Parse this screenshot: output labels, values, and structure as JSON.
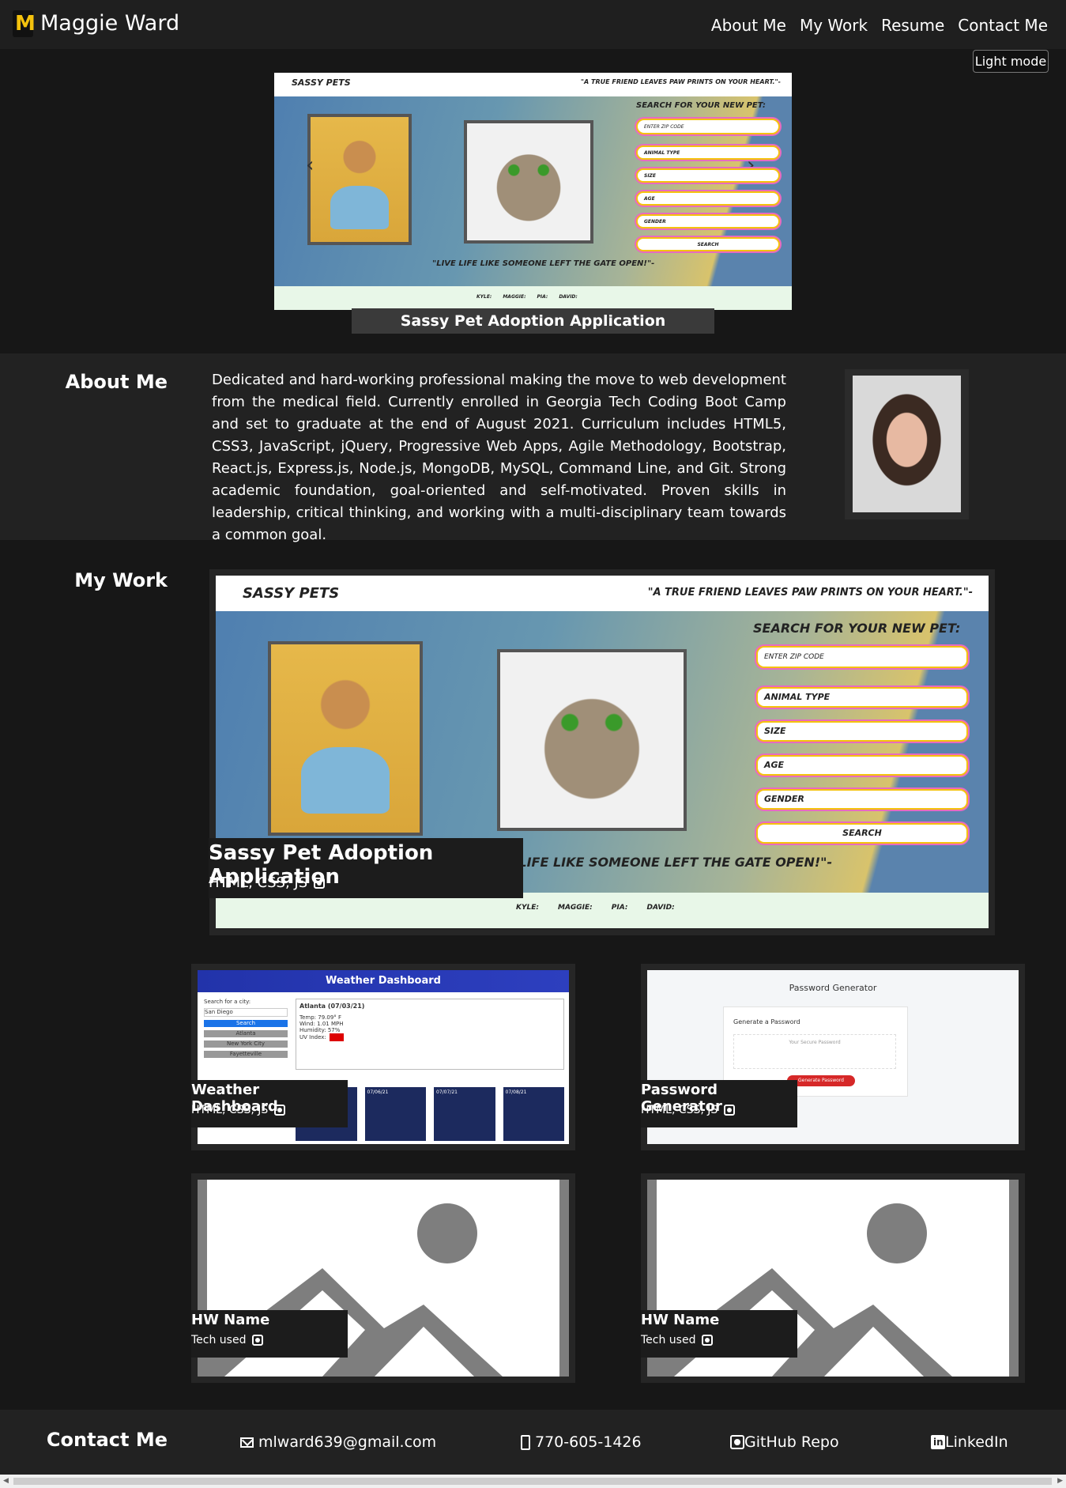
{
  "nav": {
    "brand": "Maggie Ward",
    "links": [
      "About Me",
      "My Work",
      "Resume",
      "Contact Me"
    ],
    "mode_button": "Light mode"
  },
  "hero": {
    "caption": "Sassy Pet Adoption Application"
  },
  "shot_text": {
    "brand": "SASSY PETS",
    "quote": "\"A TRUE FRIEND LEAVES PAW PRINTS ON YOUR HEART.\"-",
    "search_title": "SEARCH FOR YOUR NEW PET:",
    "zip_placeholder": "ENTER ZIP CODE",
    "fields": [
      "ANIMAL TYPE",
      "SIZE",
      "AGE",
      "GENDER"
    ],
    "search_button": "SEARCH",
    "bottom_quote": "\"LIVE LIFE LIKE SOMEONE LEFT THE GATE OPEN!\"-",
    "names": [
      "KYLE:",
      "MAGGIE:",
      "PIA:",
      "DAVID:"
    ]
  },
  "about": {
    "heading": "About Me",
    "text": "Dedicated and hard-working professional making the move to web development from the medical field. Currently enrolled in Georgia Tech Coding Boot Camp and set to graduate at the end of August 2021. Curriculum includes HTML5, CSS3, JavaScript, jQuery, Progressive Web Apps, Agile Methodology, Bootstrap, React.js, Express.js, Node.js, MongoDB, MySQL, Command Line, and Git. Strong academic foundation, goal-oriented and self-motivated. Proven skills in leadership, critical thinking, and working with a multi-disciplinary team towards a common goal."
  },
  "work": {
    "heading": "My Work",
    "featured": {
      "title": "Sassy Pet Adoption Application",
      "tech": "HTML, CSS, JS"
    },
    "projects": [
      {
        "title": "Weather Dashboard",
        "tech": "HTML, CSS, JS"
      },
      {
        "title": "Password Generator",
        "tech": "HTML, CSS, JS"
      },
      {
        "title": "HW Name",
        "tech": "Tech used"
      },
      {
        "title": "HW Name",
        "tech": "Tech used"
      }
    ],
    "weather": {
      "header": "Weather Dashboard",
      "search_label": "Search for a city:",
      "search_placeholder": "San Diego",
      "search_button": "Search",
      "cities": [
        "Atlanta",
        "New York City",
        "Fayetteville"
      ],
      "current_title": "Atlanta (07/03/21)",
      "current": [
        "Temp: 79.09° F",
        "Wind: 1.01 MPH",
        "Humidity: 57%",
        "UV Index:"
      ],
      "days": [
        "07/05/21",
        "07/06/21",
        "07/07/21",
        "07/08/21"
      ]
    },
    "password": {
      "header": "Password Generator",
      "label": "Generate a Password",
      "placeholder": "Your Secure Password",
      "button": "Generate Password"
    }
  },
  "contact": {
    "heading": "Contact Me",
    "email": "mlward639@gmail.com",
    "phone": "770-605-1426",
    "github": "GitHub Repo",
    "linkedin": "LinkedIn"
  },
  "colors": {
    "background": "#171717",
    "nav": "#1f1f1f",
    "section": "#222222",
    "accent_yellow": "#f4c20d",
    "accent_pink": "#e86ac0"
  }
}
